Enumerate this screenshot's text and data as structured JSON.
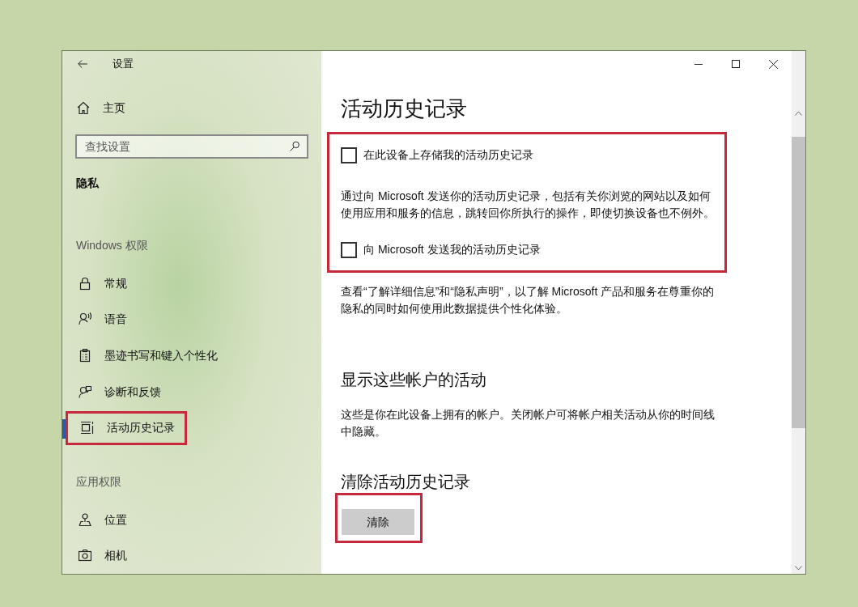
{
  "window": {
    "title": "设置"
  },
  "sidebar": {
    "home": "主页",
    "search": {
      "placeholder": "查找设置"
    },
    "category": "隐私",
    "groups": [
      {
        "heading": "Windows 权限",
        "items": [
          {
            "label": "常规",
            "kind": "lock",
            "selected": false,
            "highlighted": false
          },
          {
            "label": "语音",
            "kind": "voice",
            "selected": false,
            "highlighted": false
          },
          {
            "label": "墨迹书写和键入个性化",
            "kind": "clipboard",
            "selected": false,
            "highlighted": false
          },
          {
            "label": "诊断和反馈",
            "kind": "feedback",
            "selected": false,
            "highlighted": false
          },
          {
            "label": "活动历史记录",
            "kind": "timeline",
            "selected": true,
            "highlighted": true
          }
        ]
      },
      {
        "heading": "应用权限",
        "items": [
          {
            "label": "位置",
            "kind": "location",
            "selected": false,
            "highlighted": false
          },
          {
            "label": "相机",
            "kind": "camera",
            "selected": false,
            "highlighted": false
          }
        ]
      }
    ]
  },
  "content": {
    "title": "活动历史记录",
    "settings_group": {
      "highlighted": true,
      "items": [
        {
          "kind": "checkbox",
          "label": "在此设备上存储我的活动历史记录",
          "checked": false
        },
        {
          "kind": "text",
          "text": "通过向 Microsoft 发送你的活动历史记录，包括有关你浏览的网站以及如何使用应用和服务的信息，跳转回你所执行的操作，即使切换设备也不例外。"
        },
        {
          "kind": "checkbox",
          "label": "向 Microsoft 发送我的活动历史记录",
          "checked": false
        }
      ]
    },
    "privacy_note": "查看“了解详细信息”和“隐私声明”，以了解 Microsoft 产品和服务在尊重你的隐私的同时如何使用此数据提供个性化体验。",
    "accounts": {
      "heading": "显示这些帐户的活动",
      "text": "这些是你在此设备上拥有的帐户。关闭帐户可将帐户相关活动从你的时间线中隐藏。"
    },
    "clear": {
      "heading": "清除活动历史记录",
      "button": "清除",
      "highlighted": true
    }
  }
}
